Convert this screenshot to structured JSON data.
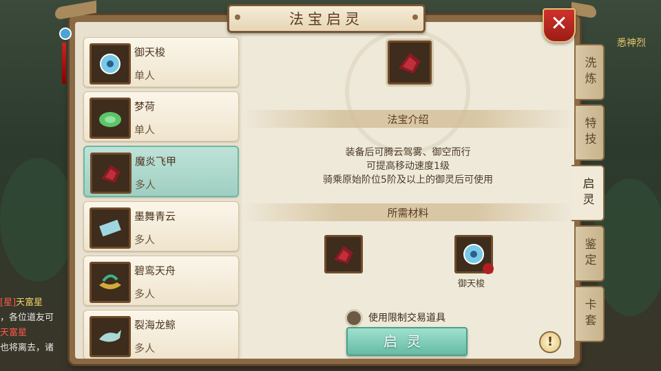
{
  "window": {
    "title": "法宝启灵",
    "close_label": "✕"
  },
  "background": {
    "right_label": "悉神烈",
    "chat": [
      {
        "tag": "[星]",
        "name": "天富星",
        "text": ""
      },
      {
        "tag": "",
        "name": "",
        "text": "，各位道友可"
      },
      {
        "tag": "",
        "name": "天富星",
        "text": ""
      },
      {
        "tag": "",
        "name": "",
        "text": "也将离去，诸"
      }
    ]
  },
  "list": {
    "items": [
      {
        "name": "御天梭",
        "type": "单人",
        "icon": "tianguo-shuttle-icon",
        "selected": false
      },
      {
        "name": "梦荷",
        "type": "单人",
        "icon": "lotus-leaf-icon",
        "selected": false
      },
      {
        "name": "魔炎飞甲",
        "type": "多人",
        "icon": "demon-flame-armor-icon",
        "selected": true
      },
      {
        "name": "墨舞青云",
        "type": "多人",
        "icon": "ink-scroll-icon",
        "selected": false
      },
      {
        "name": "碧鸾天舟",
        "type": "多人",
        "icon": "phoenix-boat-icon",
        "selected": false
      },
      {
        "name": "裂海龙鲸",
        "type": "多人",
        "icon": "dragon-whale-icon",
        "selected": false
      }
    ]
  },
  "detail": {
    "intro_title": "法宝介绍",
    "intro_lines": [
      "装备后可腾云驾雾、御空而行",
      "可提高移动速度1级",
      "骑乘原始阶位5阶及以上的御灵后可使用"
    ],
    "materials_title": "所需材料",
    "materials": [
      {
        "icon": "demon-flame-armor-icon",
        "label": ""
      },
      {
        "icon": "tianguo-shuttle-icon",
        "label": "御天梭"
      }
    ],
    "checkbox_label": "使用限制交易道具",
    "action_label": "启灵",
    "info_label": "!"
  },
  "tabs": [
    {
      "label": "洗炼",
      "active": false
    },
    {
      "label": "特技",
      "active": false
    },
    {
      "label": "启灵",
      "active": true
    },
    {
      "label": "鉴定",
      "active": false
    },
    {
      "label": "卡套",
      "active": false
    }
  ],
  "colors": {
    "accent": "#66bba4",
    "close": "#c0281f",
    "panel": "#e9e1cf"
  }
}
